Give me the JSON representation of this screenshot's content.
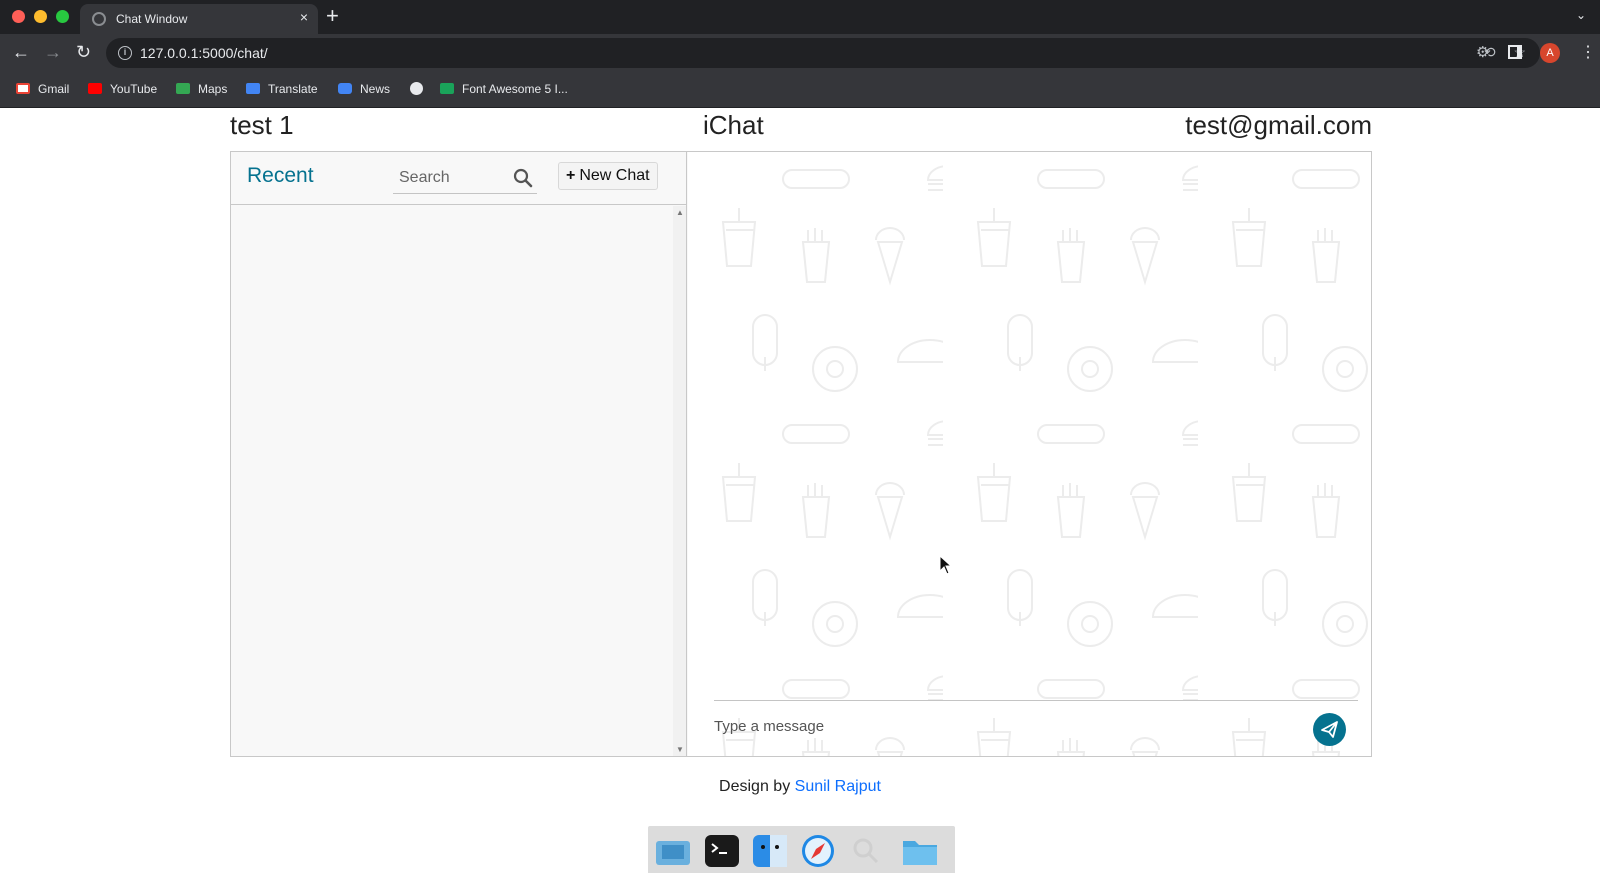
{
  "browser": {
    "tab_title": "Chat Window",
    "tab_close": "×",
    "new_tab": "+",
    "tab_search": "⌄",
    "url": "127.0.0.1:5000/chat/",
    "profile_initial": "A",
    "bookmarks": [
      {
        "label": "Gmail",
        "color": "#ea4335"
      },
      {
        "label": "YouTube",
        "color": "#ff0000"
      },
      {
        "label": "Maps",
        "color": "#34a853"
      },
      {
        "label": "Translate",
        "color": "#4285f4"
      },
      {
        "label": "News",
        "color": "#4285f4"
      },
      {
        "label": "",
        "color": "#e8eaed"
      },
      {
        "label": "Font Awesome 5 I...",
        "color": "#1aa35a"
      }
    ]
  },
  "header": {
    "username": "test 1",
    "app_name": "iChat",
    "email": "test@gmail.com"
  },
  "sidebar": {
    "title": "Recent",
    "search_placeholder": "Search",
    "new_chat_label": "New Chat"
  },
  "conversation": {
    "message_placeholder": "Type a message"
  },
  "footer": {
    "prefix": "Design by",
    "author": "Sunil Rajput"
  },
  "colors": {
    "accent": "#05728f",
    "link": "#0d6efd",
    "pattern": "#ececec"
  }
}
